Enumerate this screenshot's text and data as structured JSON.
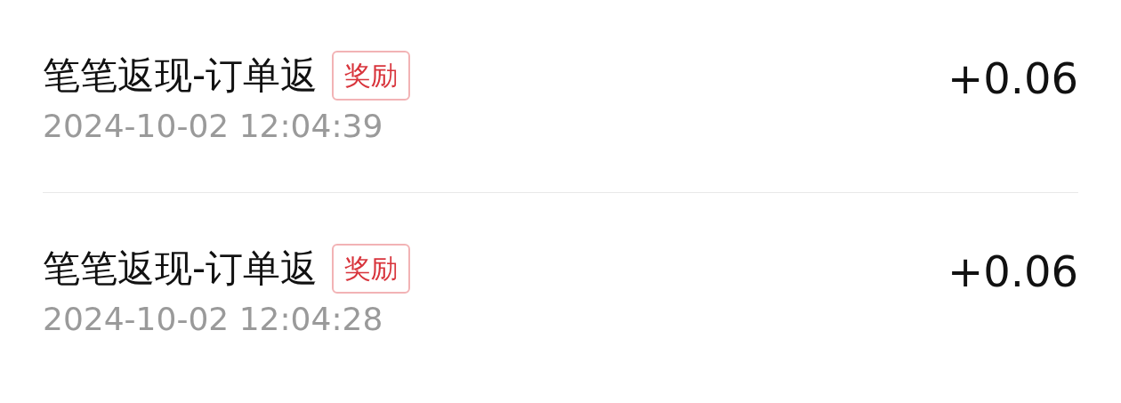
{
  "records": [
    {
      "title": "笔笔返现-订单返",
      "badge": "奖励",
      "time": "2024-10-02 12:04:39",
      "amount": "+0.06"
    },
    {
      "title": "笔笔返现-订单返",
      "badge": "奖励",
      "time": "2024-10-02 12:04:28",
      "amount": "+0.06"
    }
  ]
}
